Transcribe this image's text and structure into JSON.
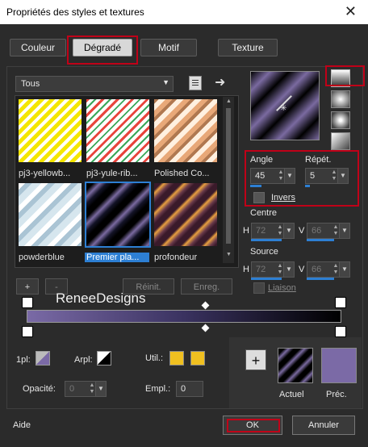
{
  "window": {
    "title": "Propriétés des styles et textures",
    "close_glyph": "✕"
  },
  "tabs": [
    {
      "label": "Couleur",
      "selected": false
    },
    {
      "label": "Dégradé",
      "selected": true
    },
    {
      "label": "Motif",
      "selected": false
    },
    {
      "label": "Texture",
      "selected": false
    }
  ],
  "category": {
    "value": "Tous"
  },
  "gradients": [
    {
      "label": "pj3-yellowb...",
      "colors": [
        "#f4e600",
        "#ffffff"
      ]
    },
    {
      "label": "pj3-yule-rib...",
      "colors": [
        "#e8443c",
        "#ffffff",
        "#3aa85a"
      ]
    },
    {
      "label": "Polished Co...",
      "colors": [
        "#e8a878",
        "#fff0e0",
        "#b07850"
      ]
    },
    {
      "label": "powderblue",
      "colors": [
        "#d6e6ee",
        "#aac4d4",
        "#ffffff"
      ]
    },
    {
      "label": "Premier pla...",
      "colors": [
        "#141428",
        "#7a6aa0",
        "#000000"
      ],
      "selected": true
    },
    {
      "label": "profondeur",
      "colors": [
        "#3a1a2a",
        "#e8a040",
        "#6a3a4a"
      ]
    }
  ],
  "angle": {
    "label": "Angle",
    "value": "45"
  },
  "repeat": {
    "label": "Répét.",
    "value": "5"
  },
  "invert": {
    "label": "Invers",
    "checked": false
  },
  "centre": {
    "label": "Centre",
    "h_label": "H",
    "h": "72",
    "v_label": "V",
    "v": "66"
  },
  "source": {
    "label": "Source",
    "h_label": "H",
    "h": "72",
    "v_label": "V",
    "v": "66"
  },
  "link": {
    "label": "Liaison"
  },
  "gradient_buttons": {
    "add": "+",
    "remove": "-",
    "reset": "Réinit.",
    "save": "Enreg."
  },
  "watermark": "ReneeDesigns",
  "bottom": {
    "plan1_label": "1pl:",
    "arpl_label": "Arpl:",
    "util_label": "Util.:",
    "opacity_label": "Opacité:",
    "opacity_value": "0",
    "empl_label": "Empl.:",
    "empl_value": "0",
    "actuel_label": "Actuel",
    "prec_label": "Préc.",
    "swap_glyph": "+"
  },
  "footer": {
    "help": "Aide",
    "ok": "OK",
    "cancel": "Annuler"
  },
  "colors": {
    "accent": "#2d7fd3",
    "highlight": "#c00018",
    "purple": "#7b6aa6",
    "util": "#f0c020"
  }
}
